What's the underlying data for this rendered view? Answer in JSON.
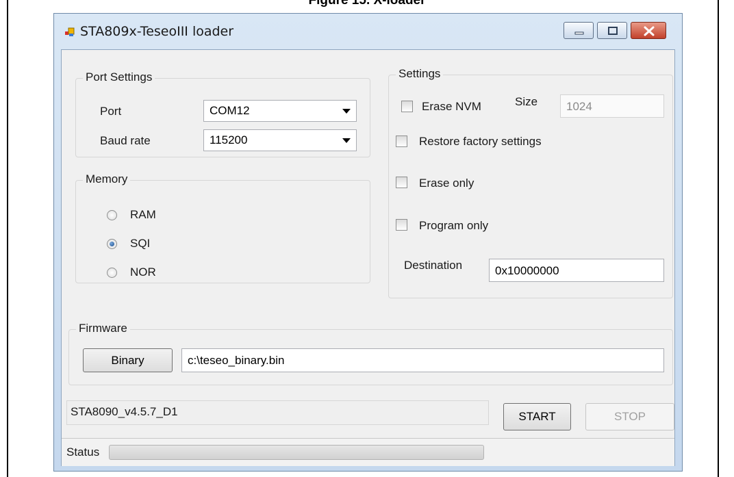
{
  "caption": "Figure 15. X-loader",
  "window": {
    "title": "STA809x-TeseoIII loader"
  },
  "port_settings": {
    "title": "Port Settings",
    "port_label": "Port",
    "port_value": "COM12",
    "baud_label": "Baud rate",
    "baud_value": "115200"
  },
  "memory": {
    "title": "Memory",
    "options": [
      {
        "label": "RAM",
        "checked": false
      },
      {
        "label": "SQI",
        "checked": true
      },
      {
        "label": "NOR",
        "checked": false
      }
    ]
  },
  "settings": {
    "title": "Settings",
    "erase_nvm": "Erase NVM",
    "size_label": "Size",
    "size_value": "1024",
    "restore_factory": "Restore factory settings",
    "erase_only": "Erase only",
    "program_only": "Program only",
    "destination_label": "Destination",
    "destination_value": "0x10000000"
  },
  "firmware": {
    "title": "Firmware",
    "binary_button": "Binary",
    "path": "c:\\teseo_binary.bin"
  },
  "version": "STA8090_v4.5.7_D1",
  "start_button": "START",
  "stop_button": "STOP",
  "status": {
    "label": "Status",
    "progress": 0
  },
  "colors": {
    "title_gradient_top": "#d9e7f5",
    "close_button": "#c2412b",
    "radio_selected": "#1c4f8f"
  },
  "icons": [
    "app-icon",
    "minimize-icon",
    "maximize-icon",
    "close-icon",
    "dropdown-arrow-icon"
  ]
}
